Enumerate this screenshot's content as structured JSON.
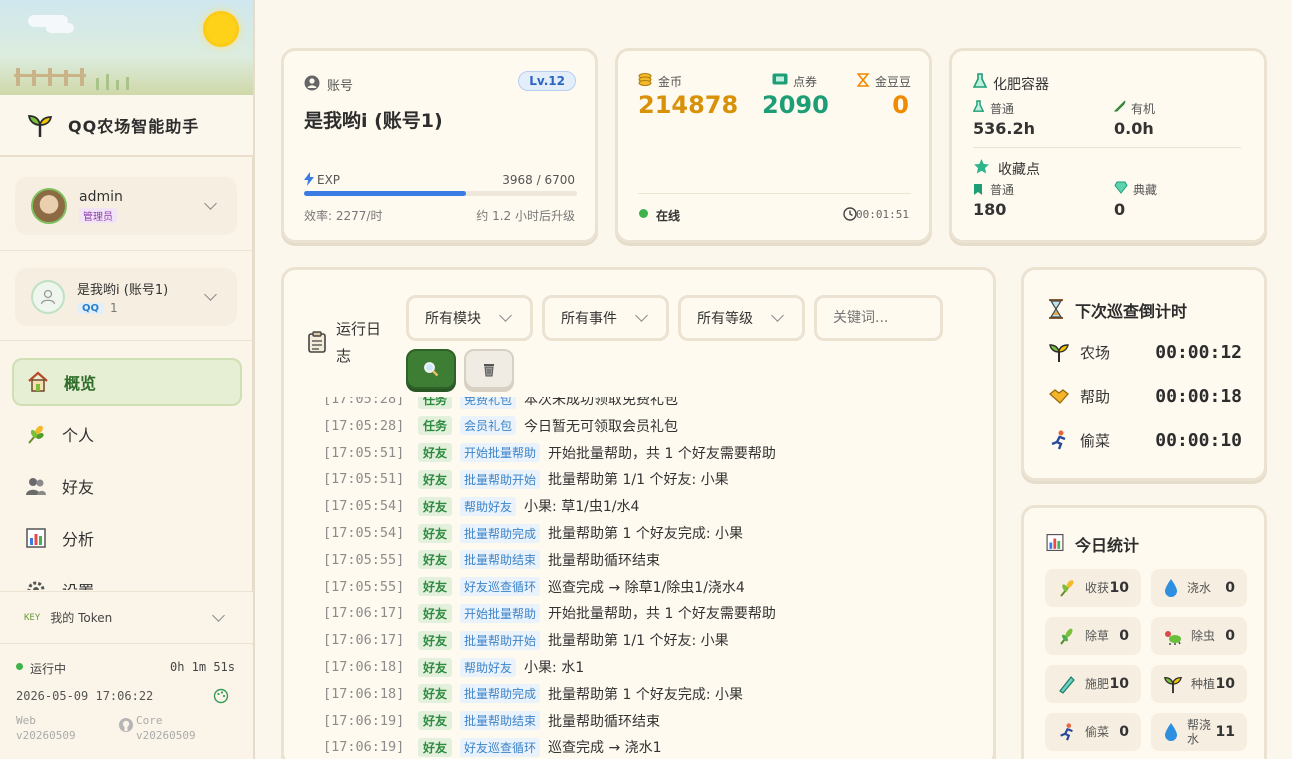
{
  "app": {
    "title": "QQ农场智能助手"
  },
  "sidebar": {
    "user": {
      "name": "admin",
      "role": "管理员"
    },
    "account": {
      "name": "是我哟i (账号1)",
      "platform": "QQ",
      "index": "1"
    },
    "nav": [
      {
        "label": "概览",
        "icon": "house-icon",
        "active": true
      },
      {
        "label": "个人",
        "icon": "wheat-icon"
      },
      {
        "label": "好友",
        "icon": "friends-icon"
      },
      {
        "label": "分析",
        "icon": "bar-chart-icon"
      },
      {
        "label": "设置",
        "icon": "gear-icon"
      }
    ],
    "token": {
      "key_label": "KEY",
      "label": "我的 Token"
    },
    "footer": {
      "status": "运行中",
      "uptime": "0h 1m 51s",
      "datetime": "2026-05-09 17:06:22",
      "web_label": "Web",
      "web_version": "v20260509",
      "core_label": "Core",
      "core_version": "v20260509"
    }
  },
  "account_card": {
    "label": "账号",
    "level": "Lv.12",
    "name": "是我哟i (账号1)",
    "exp_label": "EXP",
    "exp_value": "3968 / 6700",
    "exp_fraction": 0.592,
    "efficiency": "效率: 2277/时",
    "eta": "约 1.2 小时后升级"
  },
  "currency_card": {
    "gold_label": "金币",
    "gold": "214878",
    "coupon_label": "点券",
    "coupon": "2090",
    "bean_label": "金豆豆",
    "bean": "0",
    "status": "在线",
    "timer": "00:01:51"
  },
  "container_card": {
    "title": "化肥容器",
    "normal_label": "普通",
    "normal": "536.2h",
    "organic_label": "有机",
    "organic": "0.0h",
    "collect_title": "收藏点",
    "collect_normal_label": "普通",
    "collect_normal": "180",
    "collect_rare_label": "典藏",
    "collect_rare": "0"
  },
  "log_panel": {
    "title": "运行日志",
    "filters": {
      "module": "所有模块",
      "event": "所有事件",
      "level": "所有等级",
      "keyword_placeholder": "关键词..."
    },
    "rows": [
      {
        "time": "[17:05:28]",
        "cat": "任务",
        "tag": "免费礼包",
        "msg": "本次未成功领取免费礼包"
      },
      {
        "time": "[17:05:28]",
        "cat": "任务",
        "tag": "会员礼包",
        "msg": "今日暂无可领取会员礼包"
      },
      {
        "time": "[17:05:51]",
        "cat": "好友",
        "tag": "开始批量帮助",
        "msg": "开始批量帮助，共 1 个好友需要帮助"
      },
      {
        "time": "[17:05:51]",
        "cat": "好友",
        "tag": "批量帮助开始",
        "msg": "批量帮助第 1/1 个好友: 小果"
      },
      {
        "time": "[17:05:54]",
        "cat": "好友",
        "tag": "帮助好友",
        "msg": "小果: 草1/虫1/水4"
      },
      {
        "time": "[17:05:54]",
        "cat": "好友",
        "tag": "批量帮助完成",
        "msg": "批量帮助第 1 个好友完成: 小果"
      },
      {
        "time": "[17:05:55]",
        "cat": "好友",
        "tag": "批量帮助结束",
        "msg": "批量帮助循环结束"
      },
      {
        "time": "[17:05:55]",
        "cat": "好友",
        "tag": "好友巡查循环",
        "msg": "巡查完成 → 除草1/除虫1/浇水4"
      },
      {
        "time": "[17:06:17]",
        "cat": "好友",
        "tag": "开始批量帮助",
        "msg": "开始批量帮助，共 1 个好友需要帮助"
      },
      {
        "time": "[17:06:17]",
        "cat": "好友",
        "tag": "批量帮助开始",
        "msg": "批量帮助第 1/1 个好友: 小果"
      },
      {
        "time": "[17:06:18]",
        "cat": "好友",
        "tag": "帮助好友",
        "msg": "小果: 水1"
      },
      {
        "time": "[17:06:18]",
        "cat": "好友",
        "tag": "批量帮助完成",
        "msg": "批量帮助第 1 个好友完成: 小果"
      },
      {
        "time": "[17:06:19]",
        "cat": "好友",
        "tag": "批量帮助结束",
        "msg": "批量帮助循环结束"
      },
      {
        "time": "[17:06:19]",
        "cat": "好友",
        "tag": "好友巡查循环",
        "msg": "巡查完成 → 浇水1"
      }
    ]
  },
  "countdown": {
    "title": "下次巡查倒计时",
    "items": [
      {
        "label": "农场",
        "time": "00:00:12",
        "icon": "sprout-icon"
      },
      {
        "label": "帮助",
        "time": "00:00:18",
        "icon": "handshake-icon"
      },
      {
        "label": "偷菜",
        "time": "00:00:10",
        "icon": "runner-icon"
      }
    ]
  },
  "today_stats": {
    "title": "今日统计",
    "items": [
      {
        "label": "收获",
        "value": "10",
        "icon": "harvest-icon"
      },
      {
        "label": "浇水",
        "value": "0",
        "icon": "water-drop-icon"
      },
      {
        "label": "除草",
        "value": "0",
        "icon": "weed-icon"
      },
      {
        "label": "除虫",
        "value": "0",
        "icon": "bug-icon"
      },
      {
        "label": "施肥",
        "value": "10",
        "icon": "fertilize-icon"
      },
      {
        "label": "种植",
        "value": "10",
        "icon": "plant-icon"
      },
      {
        "label": "偷菜",
        "value": "0",
        "icon": "steal-icon"
      },
      {
        "label": "帮浇水",
        "value": "11",
        "icon": "help-water-icon"
      }
    ]
  },
  "colors": {
    "accent_green": "#3e7d34",
    "gold": "#d8920a",
    "coupon": "#1e9e76",
    "bean": "#f08a00",
    "exp_bar": "#3b7be4"
  }
}
